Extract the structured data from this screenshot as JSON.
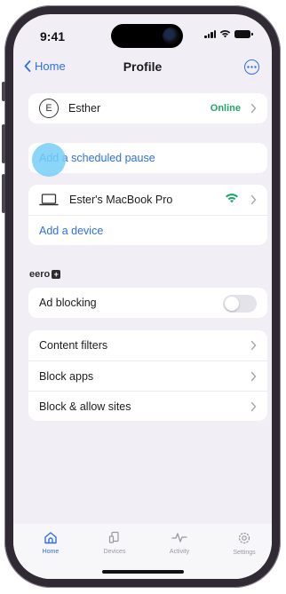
{
  "status_bar": {
    "time": "9:41"
  },
  "nav": {
    "back_label": "Home",
    "title": "Profile"
  },
  "profile_card": {
    "avatar_initial": "E",
    "name": "Esther",
    "status": "Online"
  },
  "pause_card": {
    "label": "Add a scheduled pause"
  },
  "devices_card": {
    "device_name": "Ester's MacBook Pro",
    "add_label": "Add a device"
  },
  "brand": {
    "name": "eero",
    "plus_glyph": "+"
  },
  "ad_block": {
    "label": "Ad blocking",
    "enabled": false
  },
  "settings": {
    "items": [
      {
        "label": "Content filters"
      },
      {
        "label": "Block apps"
      },
      {
        "label": "Block & allow sites"
      }
    ]
  },
  "tab_bar": {
    "tabs": [
      {
        "label": "Home",
        "icon": "home-icon",
        "active": true
      },
      {
        "label": "Devices",
        "icon": "devices-icon",
        "active": false
      },
      {
        "label": "Activity",
        "icon": "activity-icon",
        "active": false
      },
      {
        "label": "Settings",
        "icon": "settings-icon",
        "active": false
      }
    ]
  },
  "colors": {
    "accent": "#2f6fe8",
    "online": "#22a36a",
    "background": "#f1eff5",
    "touch_indicator": "#76cef7"
  }
}
